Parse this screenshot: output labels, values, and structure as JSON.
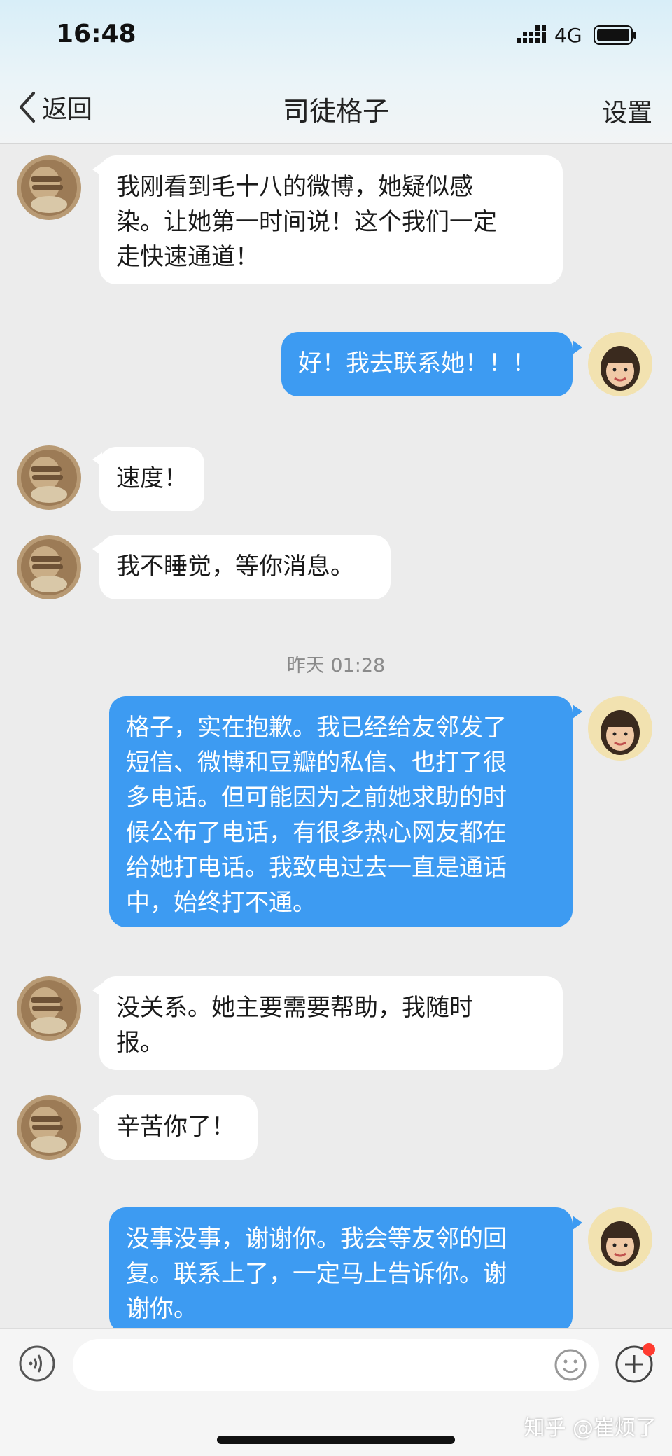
{
  "status_bar": {
    "time": "16:48",
    "network": "4G"
  },
  "nav": {
    "back_label": "返回",
    "title": "司徒格子",
    "settings_label": "设置"
  },
  "timestamp": "昨天 01:28",
  "messages": [
    {
      "side": "left",
      "text": "我刚看到毛十八的微博，她疑似感\n染。让她第一时间说！这个我们一定\n走快速通道！"
    },
    {
      "side": "right",
      "text": "好！我去联系她！！！"
    },
    {
      "side": "left",
      "text": "速度！"
    },
    {
      "side": "left",
      "text": "我不睡觉，等你消息。"
    },
    {
      "side": "right",
      "text": "格子，实在抱歉。我已经给友邻发了\n短信、微博和豆瓣的私信、也打了很\n多电话。但可能因为之前她求助的时\n候公布了电话，有很多热心网友都在\n给她打电话。我致电过去一直是通话\n中，始终打不通。"
    },
    {
      "side": "left",
      "text": "没关系。她主要需要帮助，我随时\n报。"
    },
    {
      "side": "left",
      "text": "辛苦你了！"
    },
    {
      "side": "right",
      "text": "没事没事，谢谢你。我会等友邻的回\n复。联系上了，一定马上告诉你。谢\n谢你。"
    }
  ],
  "input": {
    "placeholder": ""
  },
  "watermark": "知乎 @崔烦了",
  "icons": {
    "back": "chevron-left-icon",
    "voice": "voice-icon",
    "emoji": "emoji-icon",
    "plus": "plus-icon"
  },
  "colors": {
    "accent_bubble": "#3d9bf2",
    "received_bubble": "#ffffff",
    "chat_background": "#ececec",
    "badge": "#ff3b30"
  }
}
